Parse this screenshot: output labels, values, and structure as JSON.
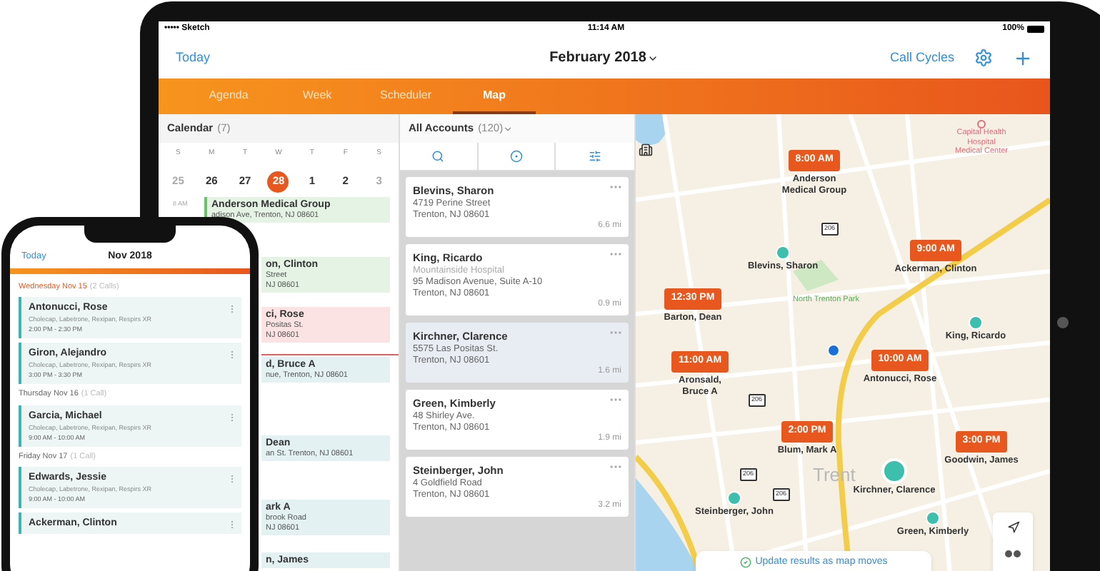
{
  "tablet": {
    "status_bar": {
      "carrier": "••••• Sketch",
      "time": "11:14 AM",
      "battery": "100%"
    },
    "nav": {
      "today": "Today",
      "title": "February 2018",
      "call_cycles": "Call Cycles"
    },
    "tabs": [
      {
        "label": "Agenda",
        "selected": false
      },
      {
        "label": "Week",
        "selected": false
      },
      {
        "label": "Scheduler",
        "selected": false
      },
      {
        "label": "Map",
        "selected": true
      }
    ],
    "calendar": {
      "title": "Calendar",
      "count": "(7)",
      "weekdays": [
        "S",
        "M",
        "T",
        "W",
        "T",
        "F",
        "S"
      ],
      "dates": [
        {
          "label": "25",
          "muted": true,
          "selected": false
        },
        {
          "label": "26",
          "muted": false,
          "selected": false
        },
        {
          "label": "27",
          "muted": false,
          "selected": false
        },
        {
          "label": "28",
          "muted": false,
          "selected": true
        },
        {
          "label": "1",
          "muted": false,
          "selected": false
        },
        {
          "label": "2",
          "muted": false,
          "selected": false
        },
        {
          "label": "3",
          "muted": true,
          "selected": false
        }
      ],
      "time_label": "8 AM",
      "events": [
        {
          "lines": [
            "Anderson Medical Group",
            "adison Ave, Trenton, NJ 08601"
          ],
          "color": "#e4f3e4"
        },
        {
          "lines": [
            "on, Clinton",
            "Street",
            "NJ 08601"
          ],
          "color": "#e4f3e4"
        },
        {
          "lines": [
            "ci, Rose",
            "Positas St.",
            "NJ 08601"
          ],
          "color": "#fbe3e3"
        },
        {
          "lines": [
            "d, Bruce A",
            "nue, Trenton, NJ 08601"
          ],
          "color": "#e3f1f3"
        },
        {
          "lines": [
            "Dean",
            "an St. Trenton, NJ 08601"
          ],
          "color": "#e3f1f3"
        },
        {
          "lines": [
            "ark A",
            "brook Road",
            "NJ 08601"
          ],
          "color": "#e3f1f3"
        },
        {
          "lines": [
            "n, James"
          ],
          "color": "#e3f1f3"
        }
      ]
    },
    "accounts": {
      "title": "All Accounts",
      "count": "(120)",
      "items": [
        {
          "name": "Blevins, Sharon",
          "address": [
            "4719 Perine Street",
            "Trenton, NJ 08601"
          ],
          "distance": "6.6 mi",
          "selected": false
        },
        {
          "name": "King, Ricardo",
          "subtitle": "Mountainside Hospital",
          "address": [
            "95 Madison Avenue, Suite A-10",
            "Trenton, NJ 08601"
          ],
          "distance": "0.9 mi",
          "selected": false
        },
        {
          "name": "Kirchner, Clarence",
          "address": [
            "5575 Las Positas St.",
            "Trenton, NJ 08601"
          ],
          "distance": "1.6 mi",
          "selected": true
        },
        {
          "name": "Green, Kimberly",
          "address": [
            "48 Shirley Ave.",
            "Trenton, NJ 08601"
          ],
          "distance": "1.9 mi",
          "selected": false
        },
        {
          "name": "Steinberger, John",
          "address": [
            "4 Goldfield Road",
            "Trenton, NJ 08601"
          ],
          "distance": "3.2 mi",
          "selected": false
        }
      ]
    },
    "map": {
      "pins": [
        {
          "kind": "time",
          "time": "8:00 AM",
          "name": [
            "Anderson",
            "Medical Group"
          ]
        },
        {
          "kind": "time",
          "time": "9:00 AM",
          "name": [
            "Ackerman, Clinton"
          ]
        },
        {
          "kind": "time",
          "time": "12:30 PM",
          "name": [
            "Barton, Dean"
          ]
        },
        {
          "kind": "time",
          "time": "11:00 AM",
          "name": [
            "Aronsald,",
            "Bruce A"
          ]
        },
        {
          "kind": "time",
          "time": "10:00 AM",
          "name": [
            "Antonucci, Rose"
          ]
        },
        {
          "kind": "time",
          "time": "2:00 PM",
          "name": [
            "Blum, Mark A"
          ]
        },
        {
          "kind": "time",
          "time": "3:00 PM",
          "name": [
            "Goodwin, James"
          ]
        },
        {
          "kind": "dot",
          "name": [
            "Blevins, Sharon"
          ]
        },
        {
          "kind": "dot",
          "name": [
            "King, Ricardo"
          ]
        },
        {
          "kind": "big_dot",
          "name": [
            "Kirchner, Clarence"
          ]
        },
        {
          "kind": "dot",
          "name": [
            "Steinberger, John"
          ]
        },
        {
          "kind": "dot",
          "name": [
            "Green, Kimberly"
          ]
        }
      ],
      "hospital": [
        "Capital Health",
        "Hospital",
        "Medical Center"
      ],
      "park": "North Trenton Park",
      "city": "Trent",
      "shields": [
        "206",
        "206",
        "206",
        "206"
      ],
      "update": "Update results as map moves"
    }
  },
  "phone": {
    "nav": {
      "today": "Today",
      "title": "Nov 2018"
    },
    "days": [
      {
        "day": "Wednesday Nov 15",
        "count": "(2 Calls)",
        "today": true,
        "calls": [
          {
            "name": "Antonucci, Rose",
            "products": "Cholecap, Labetrone, Rexipan, Respirs XR",
            "time": "2:00 PM - 2:30 PM"
          },
          {
            "name": "Giron, Alejandro",
            "products": "Cholecap, Labetrone, Rexipan, Respirs XR",
            "time": "3:00 PM - 3:30 PM"
          }
        ]
      },
      {
        "day": "Thursday Nov 16",
        "count": "(1 Call)",
        "today": false,
        "calls": [
          {
            "name": "Garcia, Michael",
            "products": "Cholecap, Labetrone, Rexipan, Respirs XR",
            "time": "9:00 AM - 10:00 AM"
          }
        ]
      },
      {
        "day": "Friday Nov 17",
        "count": "(1 Call)",
        "today": false,
        "calls": [
          {
            "name": "Edwards, Jessie",
            "products": "Cholecap, Labetrone, Rexipan, Respirs XR",
            "time": "9:00 AM - 10:00 AM"
          },
          {
            "name": "Ackerman, Clinton"
          }
        ]
      }
    ]
  }
}
